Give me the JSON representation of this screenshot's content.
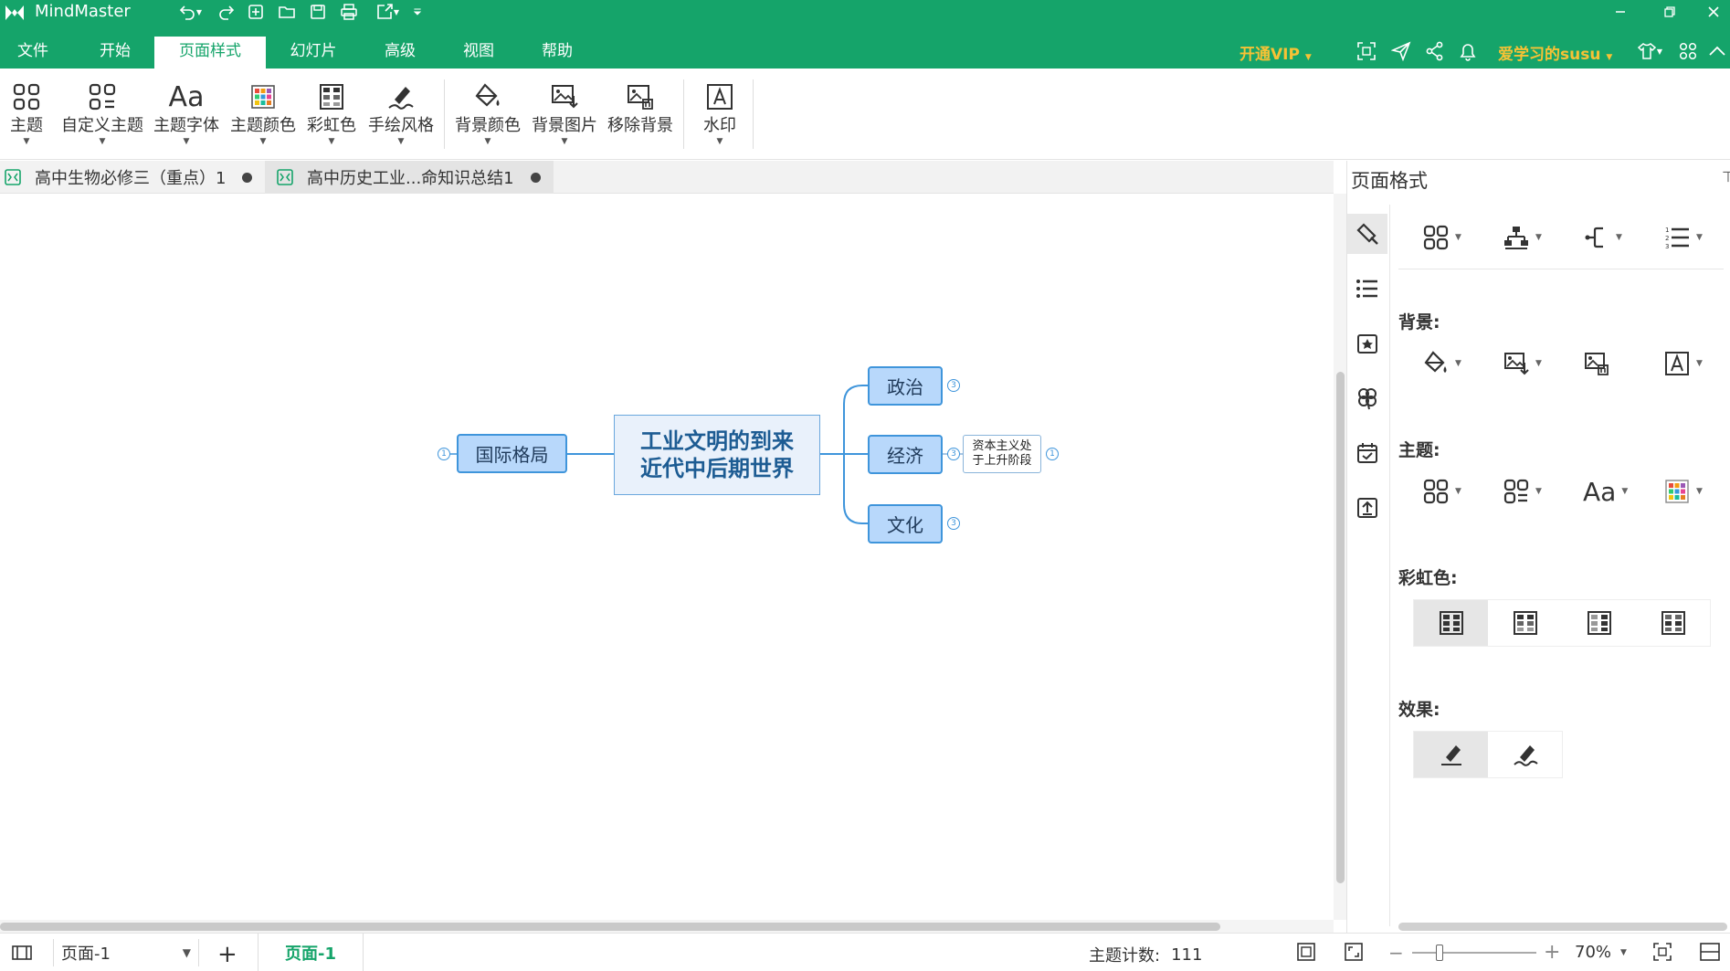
{
  "app": {
    "name": "MindMaster",
    "accent": "#15a46a"
  },
  "quick_access": [
    "undo-icon",
    "redo-icon",
    "new-icon",
    "open-icon",
    "save-icon",
    "print-icon",
    "export-icon",
    "customize-icon"
  ],
  "menu": {
    "tabs": [
      {
        "label": "文件"
      },
      {
        "label": "开始"
      },
      {
        "label": "页面样式",
        "active": true
      },
      {
        "label": "幻灯片"
      },
      {
        "label": "高级"
      },
      {
        "label": "视图"
      },
      {
        "label": "帮助"
      }
    ],
    "vip_label": "开通VIP",
    "user_label": "爱学习的susu"
  },
  "ribbon": {
    "theme": "主题",
    "custom_theme": "自定义主题",
    "theme_font": "主题字体",
    "theme_color": "主题颜色",
    "rainbow": "彩虹色",
    "hand_drawn": "手绘风格",
    "bg_color": "背景颜色",
    "bg_image": "背景图片",
    "remove_bg": "移除背景",
    "watermark": "水印"
  },
  "doc_tabs": [
    {
      "label": "高中生物必修三（重点）1",
      "active": false
    },
    {
      "label": "高中历史工业...命知识总结1",
      "active": true
    }
  ],
  "mindmap": {
    "central": {
      "line1": "工业文明的到来",
      "line2": "近代中后期世界"
    },
    "left": {
      "label": "国际格局",
      "badge": "1"
    },
    "right": [
      {
        "label": "政治",
        "badge": "3"
      },
      {
        "label": "经济",
        "badge": "3"
      },
      {
        "label": "文化",
        "badge": "3"
      }
    ],
    "leaf": {
      "line1": "资本主义处",
      "line2": "于上升阶段",
      "badge": "1"
    }
  },
  "panel": {
    "title": "页面格式",
    "sections": {
      "background": "背景:",
      "theme": "主题:",
      "rainbow": "彩虹色:",
      "effect": "效果:"
    }
  },
  "status": {
    "page_select": "页面-1",
    "page_tab": "页面-1",
    "topic_count_label": "主题计数:",
    "topic_count": "111",
    "zoom": "70%"
  }
}
